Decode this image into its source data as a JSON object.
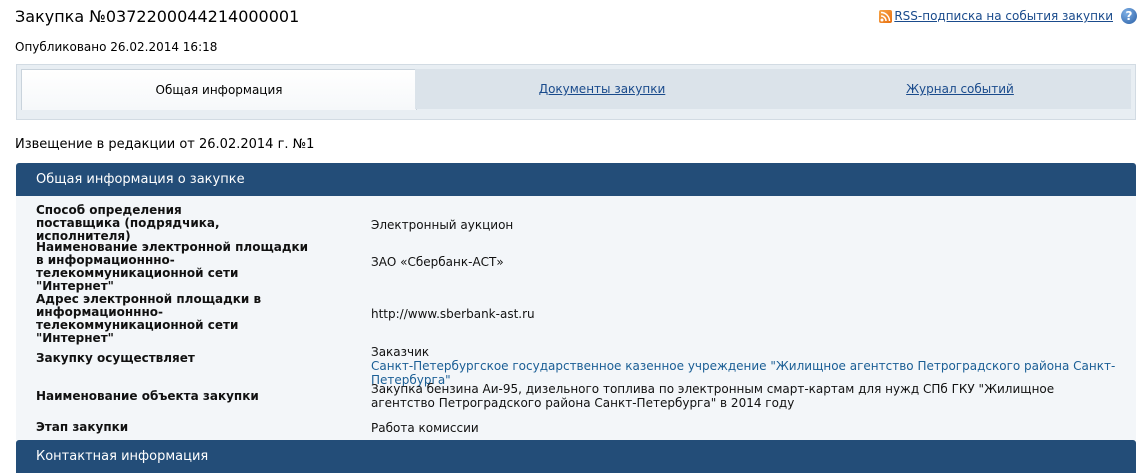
{
  "header": {
    "title": "Закупка №0372200044214000001",
    "rss_label": "RSS-подписка на события закупки",
    "help_label": "?",
    "published": "Опубликовано 26.02.2014 16:18"
  },
  "tabs": [
    {
      "label": "Общая информация",
      "active": true
    },
    {
      "label": "Документы закупки",
      "active": false
    },
    {
      "label": "Журнал событий",
      "active": false
    }
  ],
  "notice": "Извещение в редакции от 26.02.2014 г. №1",
  "sections": {
    "general_title": "Общая информация о закупке",
    "contact_title": "Контактная информация"
  },
  "rows": [
    {
      "label": "Способ определения поставщика (подрядчика, исполнителя)",
      "value": "Электронный аукцион"
    },
    {
      "label": "Наименование электронной площадки в информационнно-телекоммуникационной сети \"Интернет\"",
      "value": "ЗАО «Сбербанк-АСТ»"
    },
    {
      "label": "Адрес электронной площадки в информационнно-телекоммуникационной сети \"Интернет\"",
      "value": "http://www.sberbank-ast.ru"
    },
    {
      "label": "Закупку осуществляет",
      "value": "Заказчик",
      "link": "Санкт-Петербургское государственное казенное учреждение \"Жилищное агентство Петроградского района Санкт-Петербурга\""
    },
    {
      "label": "Наименование объекта закупки",
      "value": "Закупка бензина Аи-95, дизельного топлива по электронным смарт-картам для нужд СПб ГКУ \"Жилищное агентство Петроградского района Санкт-Петербурга\" в 2014 году"
    },
    {
      "label": "Этап закупки",
      "value": "Работа комиссии"
    }
  ],
  "colors": {
    "section_header": "#234d78",
    "link": "#1a4b8c",
    "panel_bg": "#f3f6f9"
  },
  "icons": [
    "rss-icon",
    "help-icon"
  ]
}
